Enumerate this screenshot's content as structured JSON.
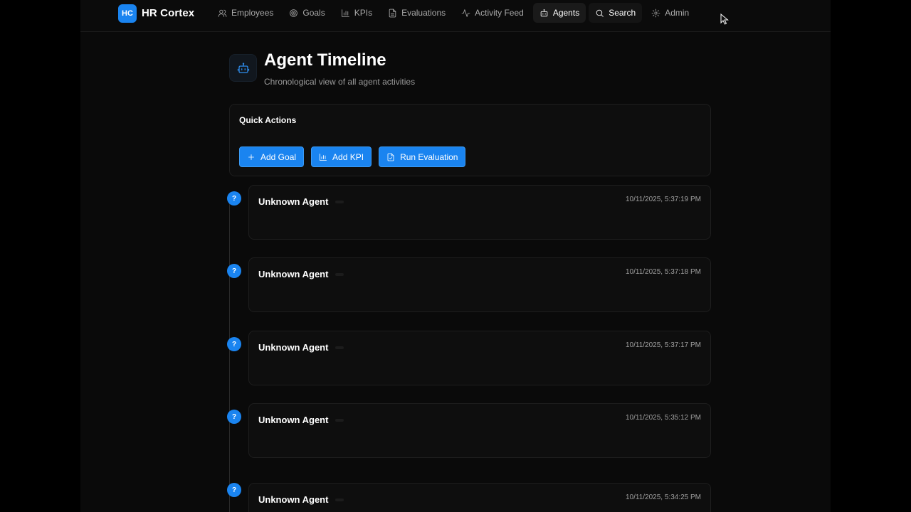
{
  "app": {
    "logo": "HC",
    "name": "HR Cortex"
  },
  "nav": [
    {
      "label": "Employees",
      "icon": "users-icon"
    },
    {
      "label": "Goals",
      "icon": "target-icon"
    },
    {
      "label": "KPIs",
      "icon": "bar-chart-icon"
    },
    {
      "label": "Evaluations",
      "icon": "file-icon"
    },
    {
      "label": "Activity Feed",
      "icon": "activity-icon"
    },
    {
      "label": "Agents",
      "icon": "bot-icon",
      "active": true
    },
    {
      "label": "Search",
      "icon": "search-icon",
      "hover": true
    },
    {
      "label": "Admin",
      "icon": "gear-icon"
    }
  ],
  "header": {
    "icon": "bot-icon",
    "title": "Agent Timeline",
    "subtitle": "Chronological view of all agent activities"
  },
  "quick_actions": {
    "title": "Quick Actions",
    "buttons": [
      {
        "label": "Add Goal",
        "icon": "plus-icon"
      },
      {
        "label": "Add KPI",
        "icon": "bar-chart-icon"
      },
      {
        "label": "Run Evaluation",
        "icon": "file-check-icon"
      }
    ]
  },
  "timeline": [
    {
      "marker": "?",
      "agent": "Unknown Agent",
      "time": "10/11/2025, 5:37:19 PM"
    },
    {
      "marker": "?",
      "agent": "Unknown Agent",
      "time": "10/11/2025, 5:37:18 PM"
    },
    {
      "marker": "?",
      "agent": "Unknown Agent",
      "time": "10/11/2025, 5:37:17 PM"
    },
    {
      "marker": "?",
      "agent": "Unknown Agent",
      "time": "10/11/2025, 5:35:12 PM"
    },
    {
      "marker": "?",
      "agent": "Unknown Agent",
      "time": "10/11/2025, 5:34:25 PM"
    }
  ],
  "colors": {
    "accent": "#1a84f0",
    "background": "#0a0a0a",
    "card": "#0e0e0e"
  }
}
